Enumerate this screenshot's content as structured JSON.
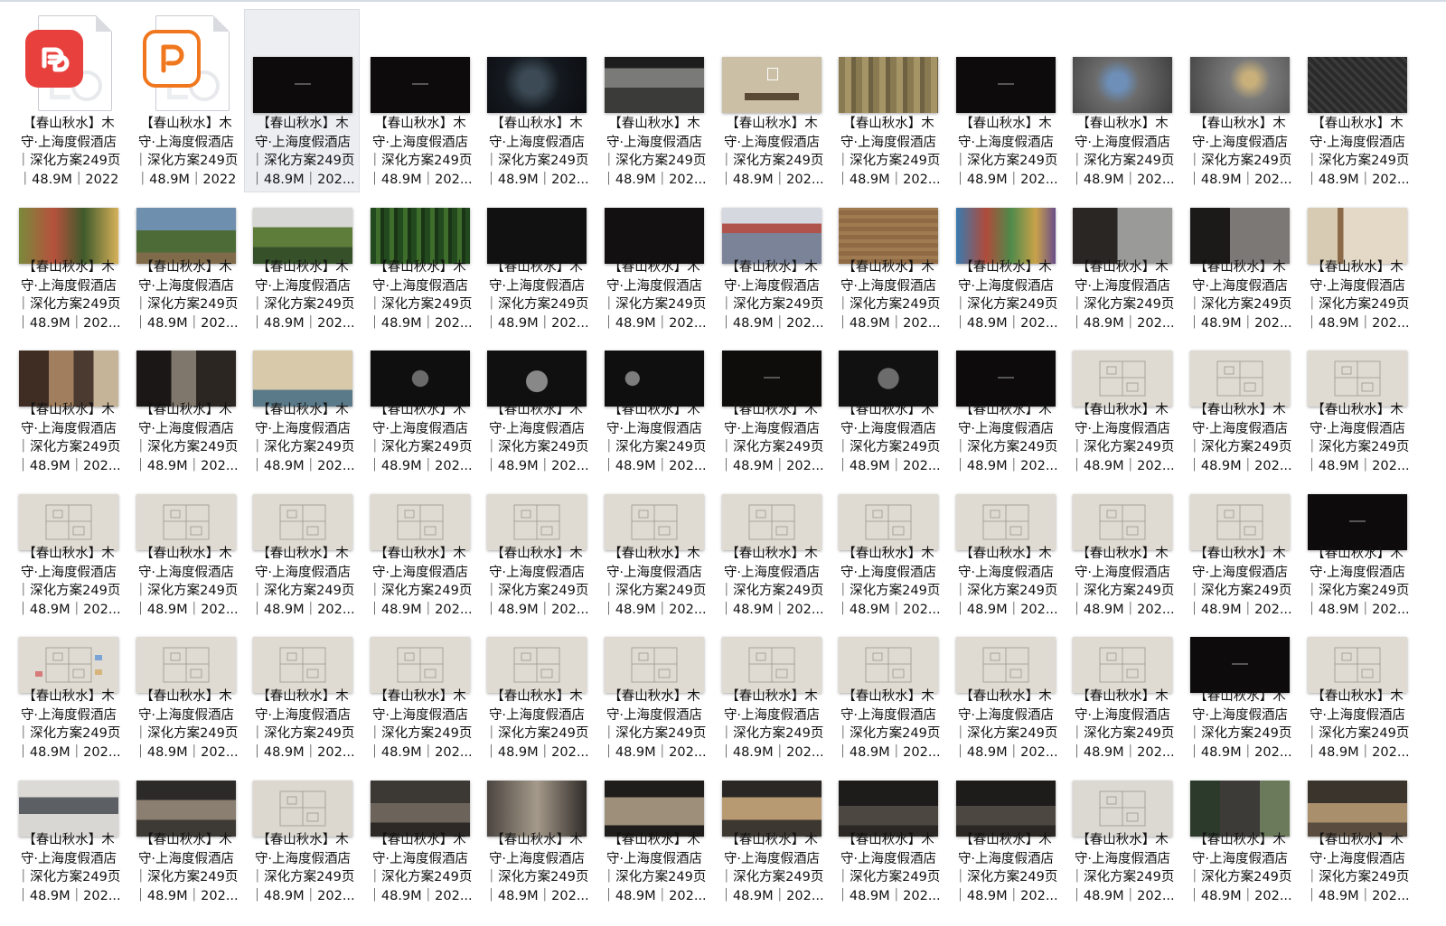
{
  "caption_lines": [
    "【春山秋水】木",
    "守·上海度假酒店",
    "｜深化方案249页"
  ],
  "size_line_full": "｜48.9M｜2022",
  "size_line_trunc": "｜48.9M｜202...",
  "files": [
    {
      "type": "wps-pdf",
      "icon": "wps-pdf-icon",
      "last": "full"
    },
    {
      "type": "wps-ppt",
      "icon": "wps-presentation-icon",
      "last": "full"
    },
    {
      "type": "dark",
      "selected": true
    },
    {
      "type": "dark"
    },
    {
      "type": "darkpond"
    },
    {
      "type": "forest"
    },
    {
      "type": "beige"
    },
    {
      "type": "painting"
    },
    {
      "type": "dark"
    },
    {
      "type": "map"
    },
    {
      "type": "map2"
    },
    {
      "type": "mapdark"
    },
    {
      "type": "collage"
    },
    {
      "type": "garden"
    },
    {
      "type": "landscape"
    },
    {
      "type": "green"
    },
    {
      "type": "darkdiagram"
    },
    {
      "type": "darkdiagram2"
    },
    {
      "type": "water"
    },
    {
      "type": "brown"
    },
    {
      "type": "colorful"
    },
    {
      "type": "interior"
    },
    {
      "type": "stone"
    },
    {
      "type": "window"
    },
    {
      "type": "photos"
    },
    {
      "type": "photos2"
    },
    {
      "type": "mural"
    },
    {
      "type": "circles"
    },
    {
      "type": "circles2"
    },
    {
      "type": "circles3"
    },
    {
      "type": "darktext"
    },
    {
      "type": "circles4"
    },
    {
      "type": "dark"
    },
    {
      "type": "plan"
    },
    {
      "type": "plan"
    },
    {
      "type": "plan"
    },
    {
      "type": "plan"
    },
    {
      "type": "plan"
    },
    {
      "type": "plan"
    },
    {
      "type": "plan"
    },
    {
      "type": "plan"
    },
    {
      "type": "plan"
    },
    {
      "type": "plan"
    },
    {
      "type": "plan"
    },
    {
      "type": "plan"
    },
    {
      "type": "plan"
    },
    {
      "type": "plan"
    },
    {
      "type": "dark"
    },
    {
      "type": "plancolor"
    },
    {
      "type": "plan"
    },
    {
      "type": "plan"
    },
    {
      "type": "plan"
    },
    {
      "type": "plan"
    },
    {
      "type": "plan"
    },
    {
      "type": "plan"
    },
    {
      "type": "plan"
    },
    {
      "type": "plan"
    },
    {
      "type": "plan"
    },
    {
      "type": "dark"
    },
    {
      "type": "plan"
    },
    {
      "type": "model"
    },
    {
      "type": "room"
    },
    {
      "type": "elevation"
    },
    {
      "type": "room2"
    },
    {
      "type": "room3"
    },
    {
      "type": "furniture"
    },
    {
      "type": "lounge"
    },
    {
      "type": "room4"
    },
    {
      "type": "room4"
    },
    {
      "type": "section"
    },
    {
      "type": "room5"
    },
    {
      "type": "room6"
    }
  ]
}
